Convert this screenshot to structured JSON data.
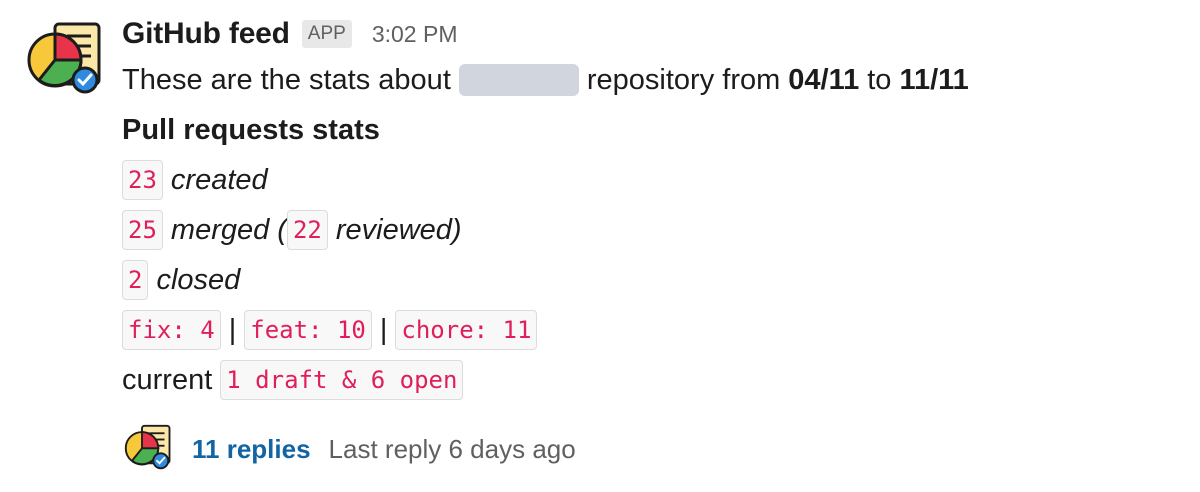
{
  "message": {
    "sender": "GitHub feed",
    "badge": "APP",
    "timestamp": "3:02 PM",
    "intro": {
      "before": "These are the stats about",
      "after": "repository from",
      "from_date": "04/11",
      "connector": "to",
      "to_date": "11/11"
    },
    "section_title": "Pull requests stats",
    "stats": {
      "created_count": "23",
      "created_label": "created",
      "merged_count": "25",
      "merged_label": "merged (",
      "reviewed_count": "22",
      "reviewed_label": "reviewed)",
      "closed_count": "2",
      "closed_label": "closed"
    },
    "tags": [
      "fix: 4",
      "feat: 10",
      "chore: 11"
    ],
    "tag_separator": "|",
    "current": {
      "label": "current",
      "value": "1 draft & 6 open"
    }
  },
  "thread": {
    "replies": "11 replies",
    "last_reply": "Last reply 6 days ago"
  },
  "icons": {
    "avatar": "pie-chart-document-check-icon"
  },
  "colors": {
    "code_text": "#e01e5a",
    "link": "#1264a3",
    "muted": "#616061"
  }
}
